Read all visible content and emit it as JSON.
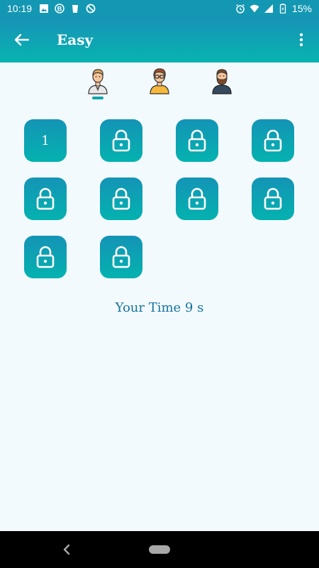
{
  "status_bar": {
    "time": "10:19",
    "battery": "15%",
    "icons": [
      "image-icon",
      "b-icon",
      "cup-icon",
      "circle-icon",
      "alarm-icon",
      "wifi-icon",
      "signal-icon",
      "battery-icon"
    ]
  },
  "app_bar": {
    "title": "Easy",
    "back_icon": "arrow-left-icon",
    "menu_icon": "more-vert-icon"
  },
  "avatars": [
    {
      "name": "avatar-businessman",
      "selected": true
    },
    {
      "name": "avatar-glasses-man",
      "selected": false
    },
    {
      "name": "avatar-bearded-man",
      "selected": false
    }
  ],
  "levels": [
    {
      "label": "1",
      "locked": false
    },
    {
      "label": "",
      "locked": true
    },
    {
      "label": "",
      "locked": true
    },
    {
      "label": "",
      "locked": true
    },
    {
      "label": "",
      "locked": true
    },
    {
      "label": "",
      "locked": true
    },
    {
      "label": "",
      "locked": true
    },
    {
      "label": "",
      "locked": true
    },
    {
      "label": "",
      "locked": true
    },
    {
      "label": "",
      "locked": true
    }
  ],
  "your_time": "Your Time 9 s",
  "colors": {
    "accent_top": "#1494b6",
    "accent_bottom": "#04b2af",
    "background": "#f3fafd",
    "time_text": "#1574a0"
  }
}
